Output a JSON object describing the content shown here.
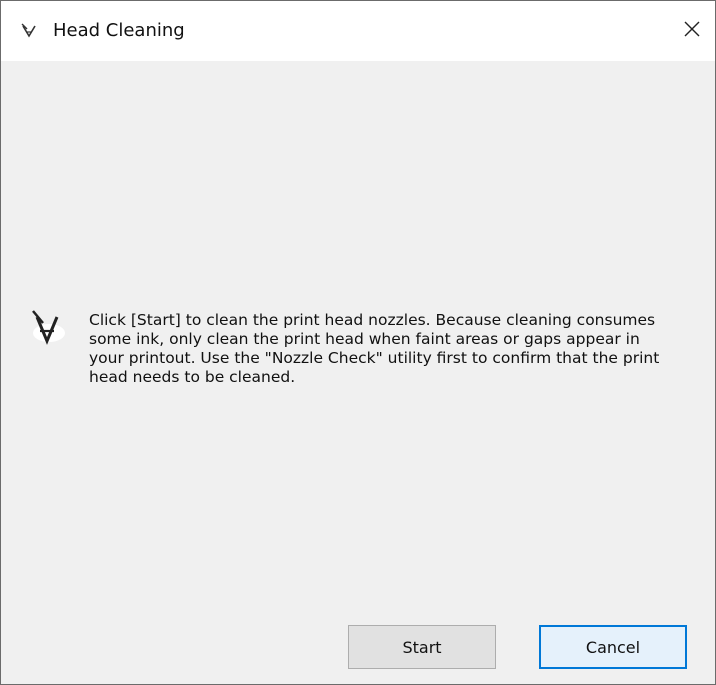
{
  "window": {
    "title": "Head Cleaning",
    "title_icon": "printer-head-icon",
    "close_icon": "close-icon"
  },
  "message": {
    "icon": "printer-head-icon",
    "text": "Click [Start] to clean the print head nozzles. Because cleaning consumes some ink, only clean the print head when faint areas or gaps appear in your printout. Use the \"Nozzle Check\" utility first to confirm that the print head needs to be cleaned."
  },
  "buttons": {
    "start_label": "Start",
    "cancel_label": "Cancel"
  },
  "colors": {
    "client_background": "#f0f0f0",
    "default_button_border": "#0078d7",
    "default_button_fill": "#e5f1fb"
  }
}
